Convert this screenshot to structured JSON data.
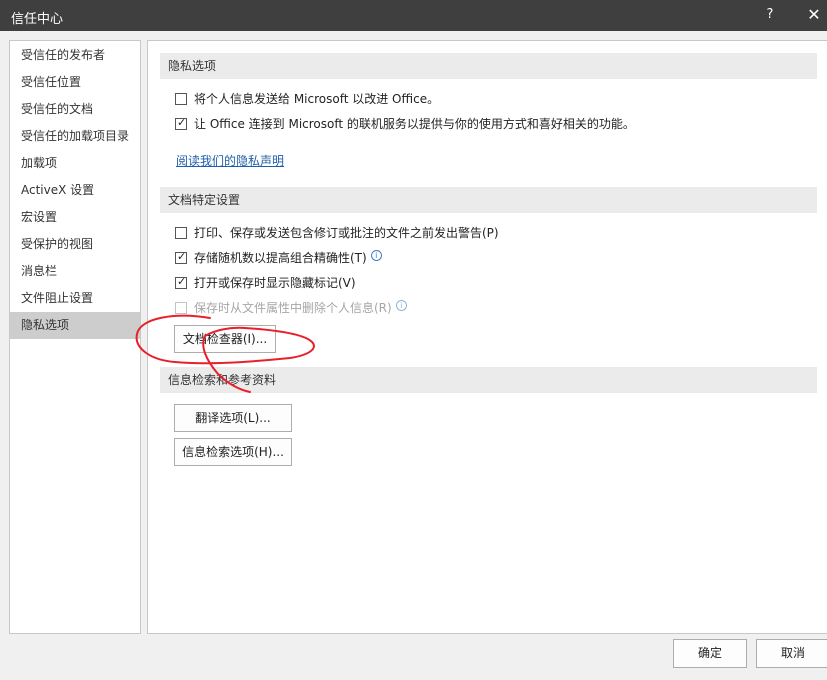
{
  "window": {
    "title": "信任中心",
    "help_label": "?",
    "close_label": "✕"
  },
  "sidebar": {
    "items": [
      {
        "label": "受信任的发布者"
      },
      {
        "label": "受信任位置"
      },
      {
        "label": "受信任的文档"
      },
      {
        "label": "受信任的加载项目录"
      },
      {
        "label": "加载项"
      },
      {
        "label": "ActiveX 设置"
      },
      {
        "label": "宏设置"
      },
      {
        "label": "受保护的视图"
      },
      {
        "label": "消息栏"
      },
      {
        "label": "文件阻止设置"
      },
      {
        "label": "隐私选项",
        "active": true
      }
    ]
  },
  "privacy": {
    "header": "隐私选项",
    "options": [
      {
        "label": "将个人信息发送给 Microsoft 以改进 Office。",
        "checked": false
      },
      {
        "label": "让 Office 连接到 Microsoft 的联机服务以提供与你的使用方式和喜好相关的功能。",
        "checked": true
      }
    ],
    "link": "阅读我们的隐私声明"
  },
  "doc_settings": {
    "header": "文档特定设置",
    "options": [
      {
        "label": "打印、保存或发送包含修订或批注的文件之前发出警告(P)",
        "checked": false
      },
      {
        "label": "存储随机数以提高组合精确性(T)",
        "checked": true,
        "info": true
      },
      {
        "label": "打开或保存时显示隐藏标记(V)",
        "checked": true
      },
      {
        "label": "保存时从文件属性中删除个人信息(R)",
        "checked": false,
        "disabled": true,
        "info": true
      }
    ],
    "inspector_button": "文档检查器(I)..."
  },
  "research": {
    "header": "信息检索和参考资料",
    "translate_button": "翻译选项(L)...",
    "research_button": "信息检索选项(H)..."
  },
  "footer": {
    "ok": "确定",
    "cancel": "取消"
  },
  "icons": {
    "info_glyph": "i",
    "check_glyph": "✓"
  },
  "colors": {
    "titlebar": "#3f3f3f",
    "selected_nav": "#cdcdcd",
    "link": "#1f5ea8",
    "annotation_ink": "#e8202a"
  }
}
